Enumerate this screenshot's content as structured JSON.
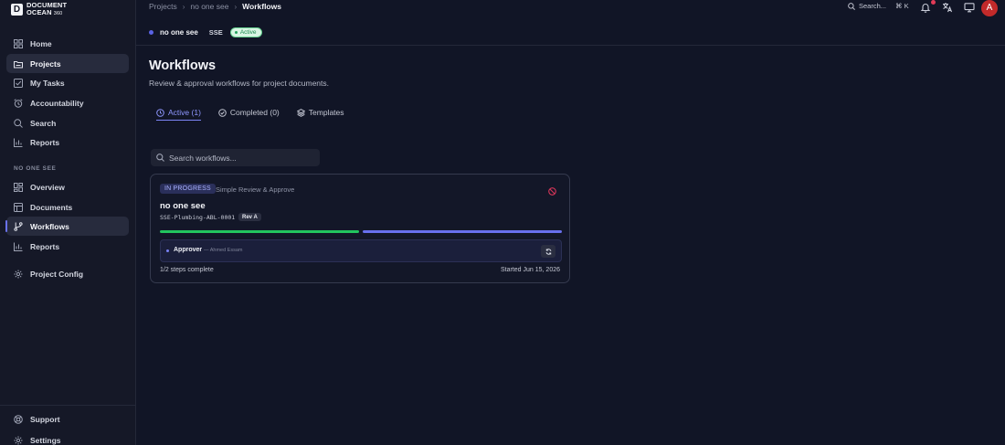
{
  "app": {
    "logo_line1": "DOCUMENT",
    "logo_line2": "OCEAN",
    "logo_num": "360"
  },
  "sidebar": {
    "main_items": [
      {
        "label": "Home",
        "icon": "home-icon"
      },
      {
        "label": "Projects",
        "icon": "projects-icon",
        "active": true
      },
      {
        "label": "My Tasks",
        "icon": "tasks-icon"
      },
      {
        "label": "Accountability",
        "icon": "alarm-icon"
      },
      {
        "label": "Search",
        "icon": "search-icon"
      },
      {
        "label": "Reports",
        "icon": "chart-icon"
      }
    ],
    "section_label": "NO ONE SEE",
    "project_items": [
      {
        "label": "Overview",
        "icon": "overview-icon"
      },
      {
        "label": "Documents",
        "icon": "documents-icon"
      },
      {
        "label": "Workflows",
        "icon": "workflow-icon",
        "active": true
      },
      {
        "label": "Reports",
        "icon": "chart-icon"
      },
      {
        "label": "Project Config",
        "icon": "gear-icon"
      }
    ],
    "bottom_items": [
      {
        "label": "Support",
        "icon": "support-icon"
      },
      {
        "label": "Settings",
        "icon": "settings-icon"
      }
    ]
  },
  "breadcrumb": [
    "Projects",
    "no one see",
    "Workflows"
  ],
  "topbar": {
    "search_label": "Search...",
    "search_shortcut": "⌘ K",
    "avatar_initial": "A"
  },
  "project": {
    "name": "no one see",
    "code": "SSE",
    "status": "Active"
  },
  "page": {
    "title": "Workflows",
    "subtitle": "Review & approval workflows for project documents."
  },
  "tabs": [
    {
      "label": "Active (1)",
      "active": true,
      "icon": "clock-icon"
    },
    {
      "label": "Completed (0)",
      "icon": "check-circle-icon"
    },
    {
      "label": "Templates",
      "icon": "layers-icon"
    }
  ],
  "search": {
    "placeholder": "Search workflows..."
  },
  "workflow": {
    "status": "IN PROGRESS",
    "template": "Simple Review & Approve",
    "title": "no one see",
    "doc_id": "SSE-Plumbing-ABL-0001",
    "revision": "Rev A",
    "progress_done": 1,
    "progress_total": 2,
    "step_role": "Approver",
    "step_person": "— Ahmed Essam",
    "steps_text": "1/2 steps complete",
    "started_text": "Started Jun 15, 2026"
  },
  "colors": {
    "background": "#111526",
    "sidebar": "#151827",
    "accent": "#6870ee",
    "success": "#22c55e",
    "danger": "#d8365a"
  }
}
